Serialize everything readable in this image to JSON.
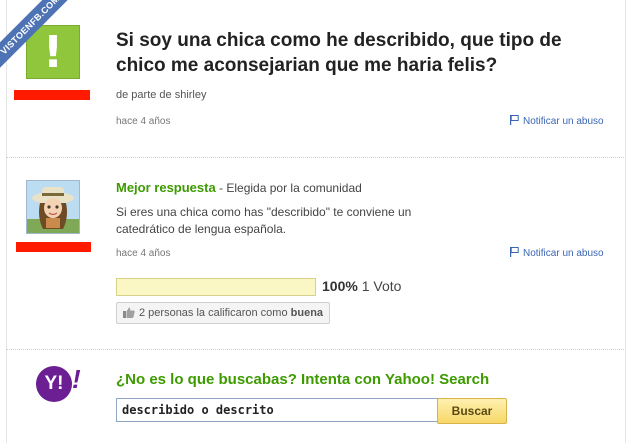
{
  "watermark": "VISTOENFB.COM",
  "question": {
    "title": "Si soy una chica como he describido, que tipo de chico me aconsejarian que me haria felis?",
    "author": "de parte de shirley",
    "time_ago": "hace 4 años",
    "report_label": "Notificar un abuso"
  },
  "answer": {
    "best_label": "Mejor respuesta",
    "chosen_by": " - Elegida por la comunidad",
    "text": "Si eres una chica como has \"describido\" te conviene un catedrático de lengua española.",
    "time_ago": "hace 4 años",
    "report_label": "Notificar un abuso",
    "rating": {
      "fraction": 1.0,
      "percent_label": "100%",
      "votes_label": " 1 Voto"
    },
    "rate_button": {
      "prefix": "2 personas la calificaron como ",
      "bold": "buena"
    }
  },
  "yahoo": {
    "logo_text": "Y!",
    "prompt": "¿No es lo que buscabas? Intenta con Yahoo! Search",
    "search_value": "describido o descrito",
    "search_button": "Buscar"
  },
  "colors": {
    "accent_green": "#3d9b00",
    "link_blue": "#3a66b3",
    "yahoo_purple": "#6b1f93",
    "redact_red": "#ff1a00"
  },
  "icons": [
    "exclamation-avatar-icon",
    "flag-icon",
    "thumbs-up-icon",
    "yahoo-logo-icon"
  ]
}
